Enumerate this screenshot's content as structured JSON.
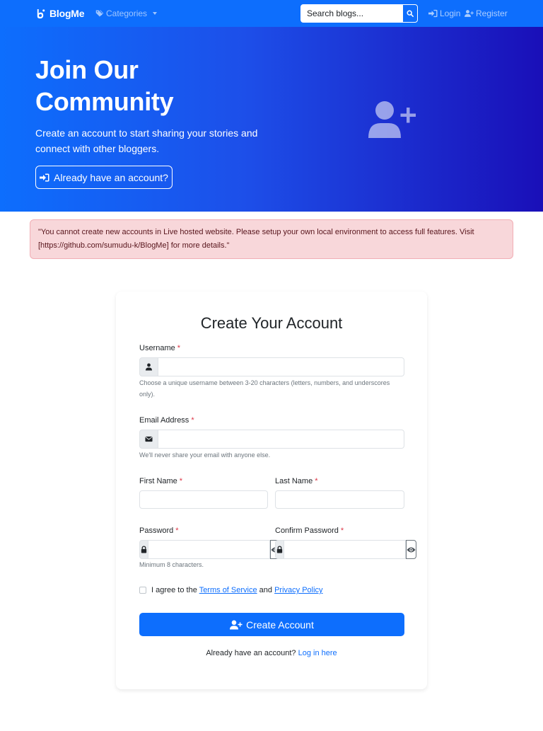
{
  "navbar": {
    "brand": "BlogMe",
    "categories_label": "Categories",
    "search_placeholder": "Search blogs...",
    "login_label": "Login",
    "register_label": "Register"
  },
  "hero": {
    "title": "Join Our Community",
    "subtitle": "Create an account to start sharing your stories and connect with other bloggers.",
    "button_label": "Already have an account?"
  },
  "alert": {
    "message": "\"You cannot create new accounts in Live hosted website. Please setup your own local environment to access full features. Visit [https://github.com/sumudu-k/BlogMe] for more details.\""
  },
  "form": {
    "title": "Create Your Account",
    "username": {
      "label": "Username",
      "value": "",
      "help": "Choose a unique username between 3-20 characters (letters, numbers, and underscores only)."
    },
    "email": {
      "label": "Email Address",
      "value": "",
      "help": "We'll never share your email with anyone else."
    },
    "first_name": {
      "label": "First Name",
      "value": ""
    },
    "last_name": {
      "label": "Last Name",
      "value": ""
    },
    "password": {
      "label": "Password",
      "value": "",
      "help": "Minimum 8 characters."
    },
    "confirm_password": {
      "label": "Confirm Password",
      "value": ""
    },
    "required_marker": "*",
    "terms": {
      "prefix": "I agree to the",
      "terms_link": "Terms of Service",
      "and": "and",
      "privacy_link": "Privacy Policy",
      "checked": false
    },
    "submit_label": "Create Account",
    "footer_text": "Already have an account?",
    "footer_link": "Log in here"
  },
  "colors": {
    "primary": "#0d6efd",
    "hero_gradient_end": "#1a0fb8",
    "alert_bg": "#f8d7da",
    "alert_text": "#58151c",
    "required": "#dc3545"
  },
  "icons": {
    "brand": "blog-logo-icon",
    "categories": "tags-icon",
    "search": "search-icon",
    "login": "sign-in-icon",
    "register": "user-plus-icon",
    "hero": "user-plus-icon",
    "username": "user-icon",
    "email": "envelope-icon",
    "password": "lock-icon",
    "toggle": "eye-icon"
  }
}
